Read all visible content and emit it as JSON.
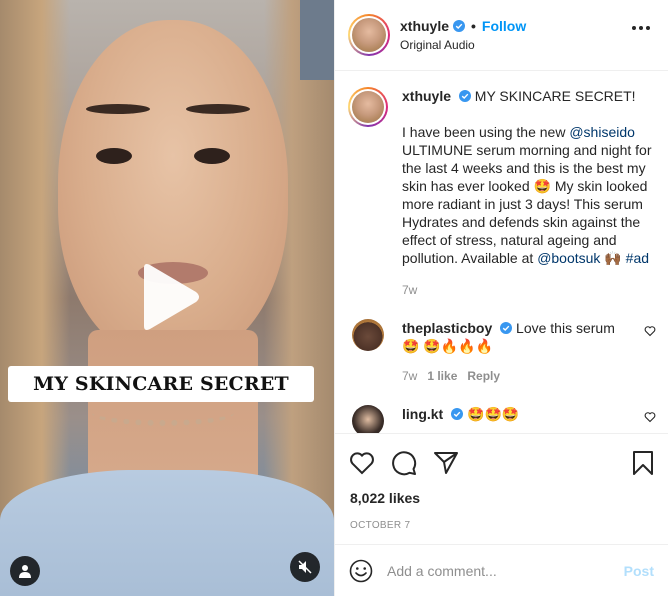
{
  "media": {
    "overlay_text": "MY SKINCARE SECRET"
  },
  "header": {
    "username": "xthuyle",
    "separator": "•",
    "follow_label": "Follow",
    "audio_label": "Original Audio"
  },
  "caption": {
    "username": "xthuyle",
    "title": "MY SKINCARE SECRET!",
    "body_prefix": "I have been using the new ",
    "mention1": "@shiseido",
    "body_middle": " ULTIMUNE serum morning and night for the last 4 weeks and this is the best my skin has ever looked 🤩 My skin looked more radiant in just 3 days! This serum Hydrates and defends skin against the effect of stress, natural ageing and pollution. Available at ",
    "mention2": "@bootsuk",
    "body_suffix": " 🙌🏾 ",
    "hashtag": "#ad",
    "time": "7w"
  },
  "comments": [
    {
      "username": "theplasticboy",
      "text": "Love this serum 🤩 🤩🔥🔥🔥",
      "time": "7w",
      "likes": "1 like",
      "reply_label": "Reply"
    },
    {
      "username": "ling.kt",
      "text": "🤩🤩🤩"
    }
  ],
  "actions": {
    "likes": "8,022 likes",
    "date": "OCTOBER 7"
  },
  "add_comment": {
    "placeholder": "Add a comment...",
    "post_label": "Post"
  },
  "colors": {
    "accent": "#0095f6",
    "verified": "#3897f0",
    "link": "#00376b",
    "muted": "#8e8e8e",
    "post_disabled": "#b2dffc"
  }
}
